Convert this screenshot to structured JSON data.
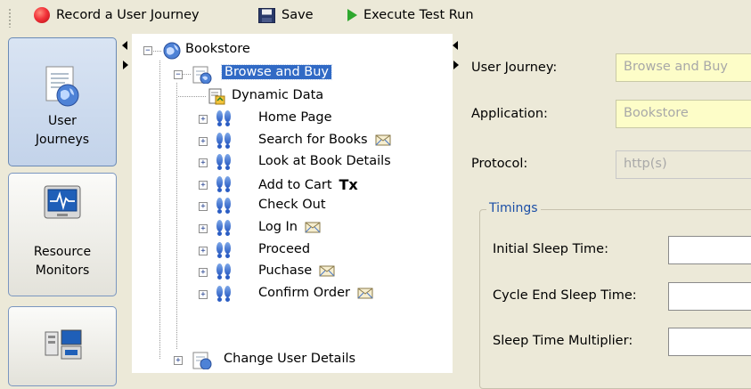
{
  "toolbar": {
    "record_label": "Record a User Journey",
    "save_label": "Save",
    "execute_label": "Execute Test Run"
  },
  "nav": {
    "items": [
      {
        "label_line1": "User",
        "label_line2": "Journeys",
        "icon": "document-globe-icon",
        "selected": true
      },
      {
        "label_line1": "Resource",
        "label_line2": "Monitors",
        "icon": "heartbeat-monitor-icon",
        "selected": false
      },
      {
        "label_line1": "",
        "label_line2": "",
        "icon": "network-computers-icon",
        "selected": false
      }
    ]
  },
  "tree": {
    "root": {
      "label": "Bookstore",
      "icon": "globe-icon",
      "expander": "−"
    },
    "journey": {
      "label": "Browse and Buy",
      "icon": "journey-icon",
      "expander": "−"
    },
    "dynamic_data": {
      "label": "Dynamic Data",
      "icon": "dynamic-data-icon"
    },
    "steps": [
      {
        "label": "Home Page",
        "expander": "+",
        "badge": ""
      },
      {
        "label": "Search for Books",
        "expander": "+",
        "badge": "mail"
      },
      {
        "label": "Look at Book Details",
        "expander": "+",
        "badge": ""
      },
      {
        "label": "Add to Cart",
        "expander": "+",
        "badge": "Tx"
      },
      {
        "label": "Check Out",
        "expander": "+",
        "badge": ""
      },
      {
        "label": "Log In",
        "expander": "+",
        "badge": "mail"
      },
      {
        "label": "Proceed",
        "expander": "+",
        "badge": ""
      },
      {
        "label": "Puchase",
        "expander": "+",
        "badge": "mail"
      },
      {
        "label": "Confirm Order",
        "expander": "+",
        "badge": "mail"
      }
    ],
    "change_user": {
      "label": "Change User Details",
      "expander": "+"
    }
  },
  "form": {
    "user_journey": {
      "label": "User Journey:",
      "value": "Browse and Buy"
    },
    "application": {
      "label": "Application:",
      "value": "Bookstore"
    },
    "protocol": {
      "label": "Protocol:",
      "value": "http(s)"
    },
    "timings": {
      "title": "Timings",
      "initial_sleep": {
        "label": "Initial Sleep Time:",
        "value": ""
      },
      "cycle_end_sleep": {
        "label": "Cycle End Sleep Time:",
        "value": ""
      },
      "sleep_multiplier": {
        "label": "Sleep Time Multiplier:",
        "value": ""
      }
    }
  },
  "colors": {
    "background": "#ece9d8",
    "selection": "#316ac5",
    "required_field": "#fdfdc8",
    "group_title": "#1c4fa6"
  }
}
